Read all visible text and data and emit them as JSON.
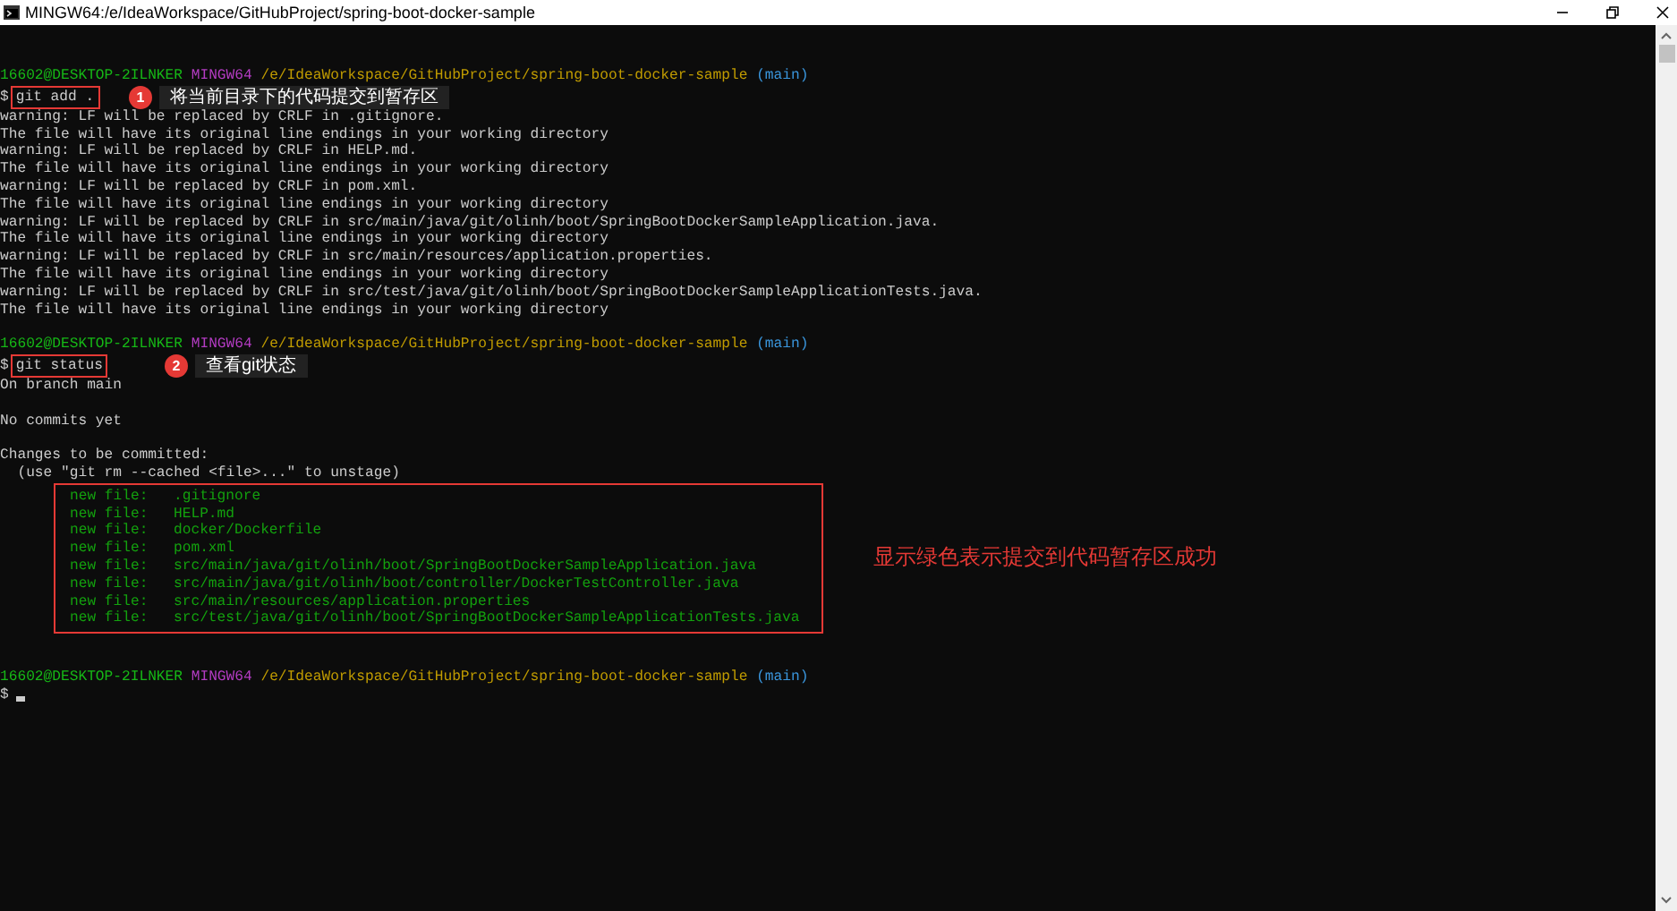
{
  "window": {
    "title": "MINGW64:/e/IdeaWorkspace/GitHubProject/spring-boot-docker-sample"
  },
  "terminal": {
    "lines": [
      {
        "kind": "prompt",
        "user": "16602@DESKTOP-2ILNKER",
        "system": "MINGW64",
        "path": "/e/IdeaWorkspace/GitHubProject/spring-boot-docker-sample",
        "branch": "(main)"
      },
      {
        "kind": "command",
        "symbol": "$",
        "text": "git add .",
        "callout": {
          "number": "1",
          "text": "将当前目录下的代码提交到暂存区"
        }
      },
      {
        "kind": "output",
        "text": "warning: LF will be replaced by CRLF in .gitignore."
      },
      {
        "kind": "output",
        "text": "The file will have its original line endings in your working directory"
      },
      {
        "kind": "output",
        "text": "warning: LF will be replaced by CRLF in HELP.md."
      },
      {
        "kind": "output",
        "text": "The file will have its original line endings in your working directory"
      },
      {
        "kind": "output",
        "text": "warning: LF will be replaced by CRLF in pom.xml."
      },
      {
        "kind": "output",
        "text": "The file will have its original line endings in your working directory"
      },
      {
        "kind": "output",
        "text": "warning: LF will be replaced by CRLF in src/main/java/git/olinh/boot/SpringBootDockerSampleApplication.java."
      },
      {
        "kind": "output",
        "text": "The file will have its original line endings in your working directory"
      },
      {
        "kind": "output",
        "text": "warning: LF will be replaced by CRLF in src/main/resources/application.properties."
      },
      {
        "kind": "output",
        "text": "The file will have its original line endings in your working directory"
      },
      {
        "kind": "output",
        "text": "warning: LF will be replaced by CRLF in src/test/java/git/olinh/boot/SpringBootDockerSampleApplicationTests.java."
      },
      {
        "kind": "output",
        "text": "The file will have its original line endings in your working directory"
      },
      {
        "kind": "blank"
      },
      {
        "kind": "prompt",
        "user": "16602@DESKTOP-2ILNKER",
        "system": "MINGW64",
        "path": "/e/IdeaWorkspace/GitHubProject/spring-boot-docker-sample",
        "branch": "(main)"
      },
      {
        "kind": "command",
        "symbol": "$",
        "text": "git status",
        "callout": {
          "number": "2",
          "text": "查看git状态"
        }
      },
      {
        "kind": "output",
        "text": "On branch main"
      },
      {
        "kind": "blank"
      },
      {
        "kind": "output",
        "text": "No commits yet"
      },
      {
        "kind": "blank"
      },
      {
        "kind": "output",
        "text": "Changes to be committed:"
      },
      {
        "kind": "output",
        "text": "  (use \"git rm --cached <file>...\" to unstage)"
      },
      {
        "kind": "staged",
        "note": "显示绿色表示提交到代码暂存区成功",
        "files": [
          {
            "label": "new file:",
            "path": ".gitignore"
          },
          {
            "label": "new file:",
            "path": "HELP.md"
          },
          {
            "label": "new file:",
            "path": "docker/Dockerfile"
          },
          {
            "label": "new file:",
            "path": "pom.xml"
          },
          {
            "label": "new file:",
            "path": "src/main/java/git/olinh/boot/SpringBootDockerSampleApplication.java"
          },
          {
            "label": "new file:",
            "path": "src/main/java/git/olinh/boot/controller/DockerTestController.java"
          },
          {
            "label": "new file:",
            "path": "src/main/resources/application.properties"
          },
          {
            "label": "new file:",
            "path": "src/test/java/git/olinh/boot/SpringBootDockerSampleApplicationTests.java"
          }
        ]
      },
      {
        "kind": "blank"
      },
      {
        "kind": "blank"
      },
      {
        "kind": "prompt",
        "user": "16602@DESKTOP-2ILNKER",
        "system": "MINGW64",
        "path": "/e/IdeaWorkspace/GitHubProject/spring-boot-docker-sample",
        "branch": "(main)"
      },
      {
        "kind": "cursor",
        "symbol": "$"
      }
    ]
  }
}
